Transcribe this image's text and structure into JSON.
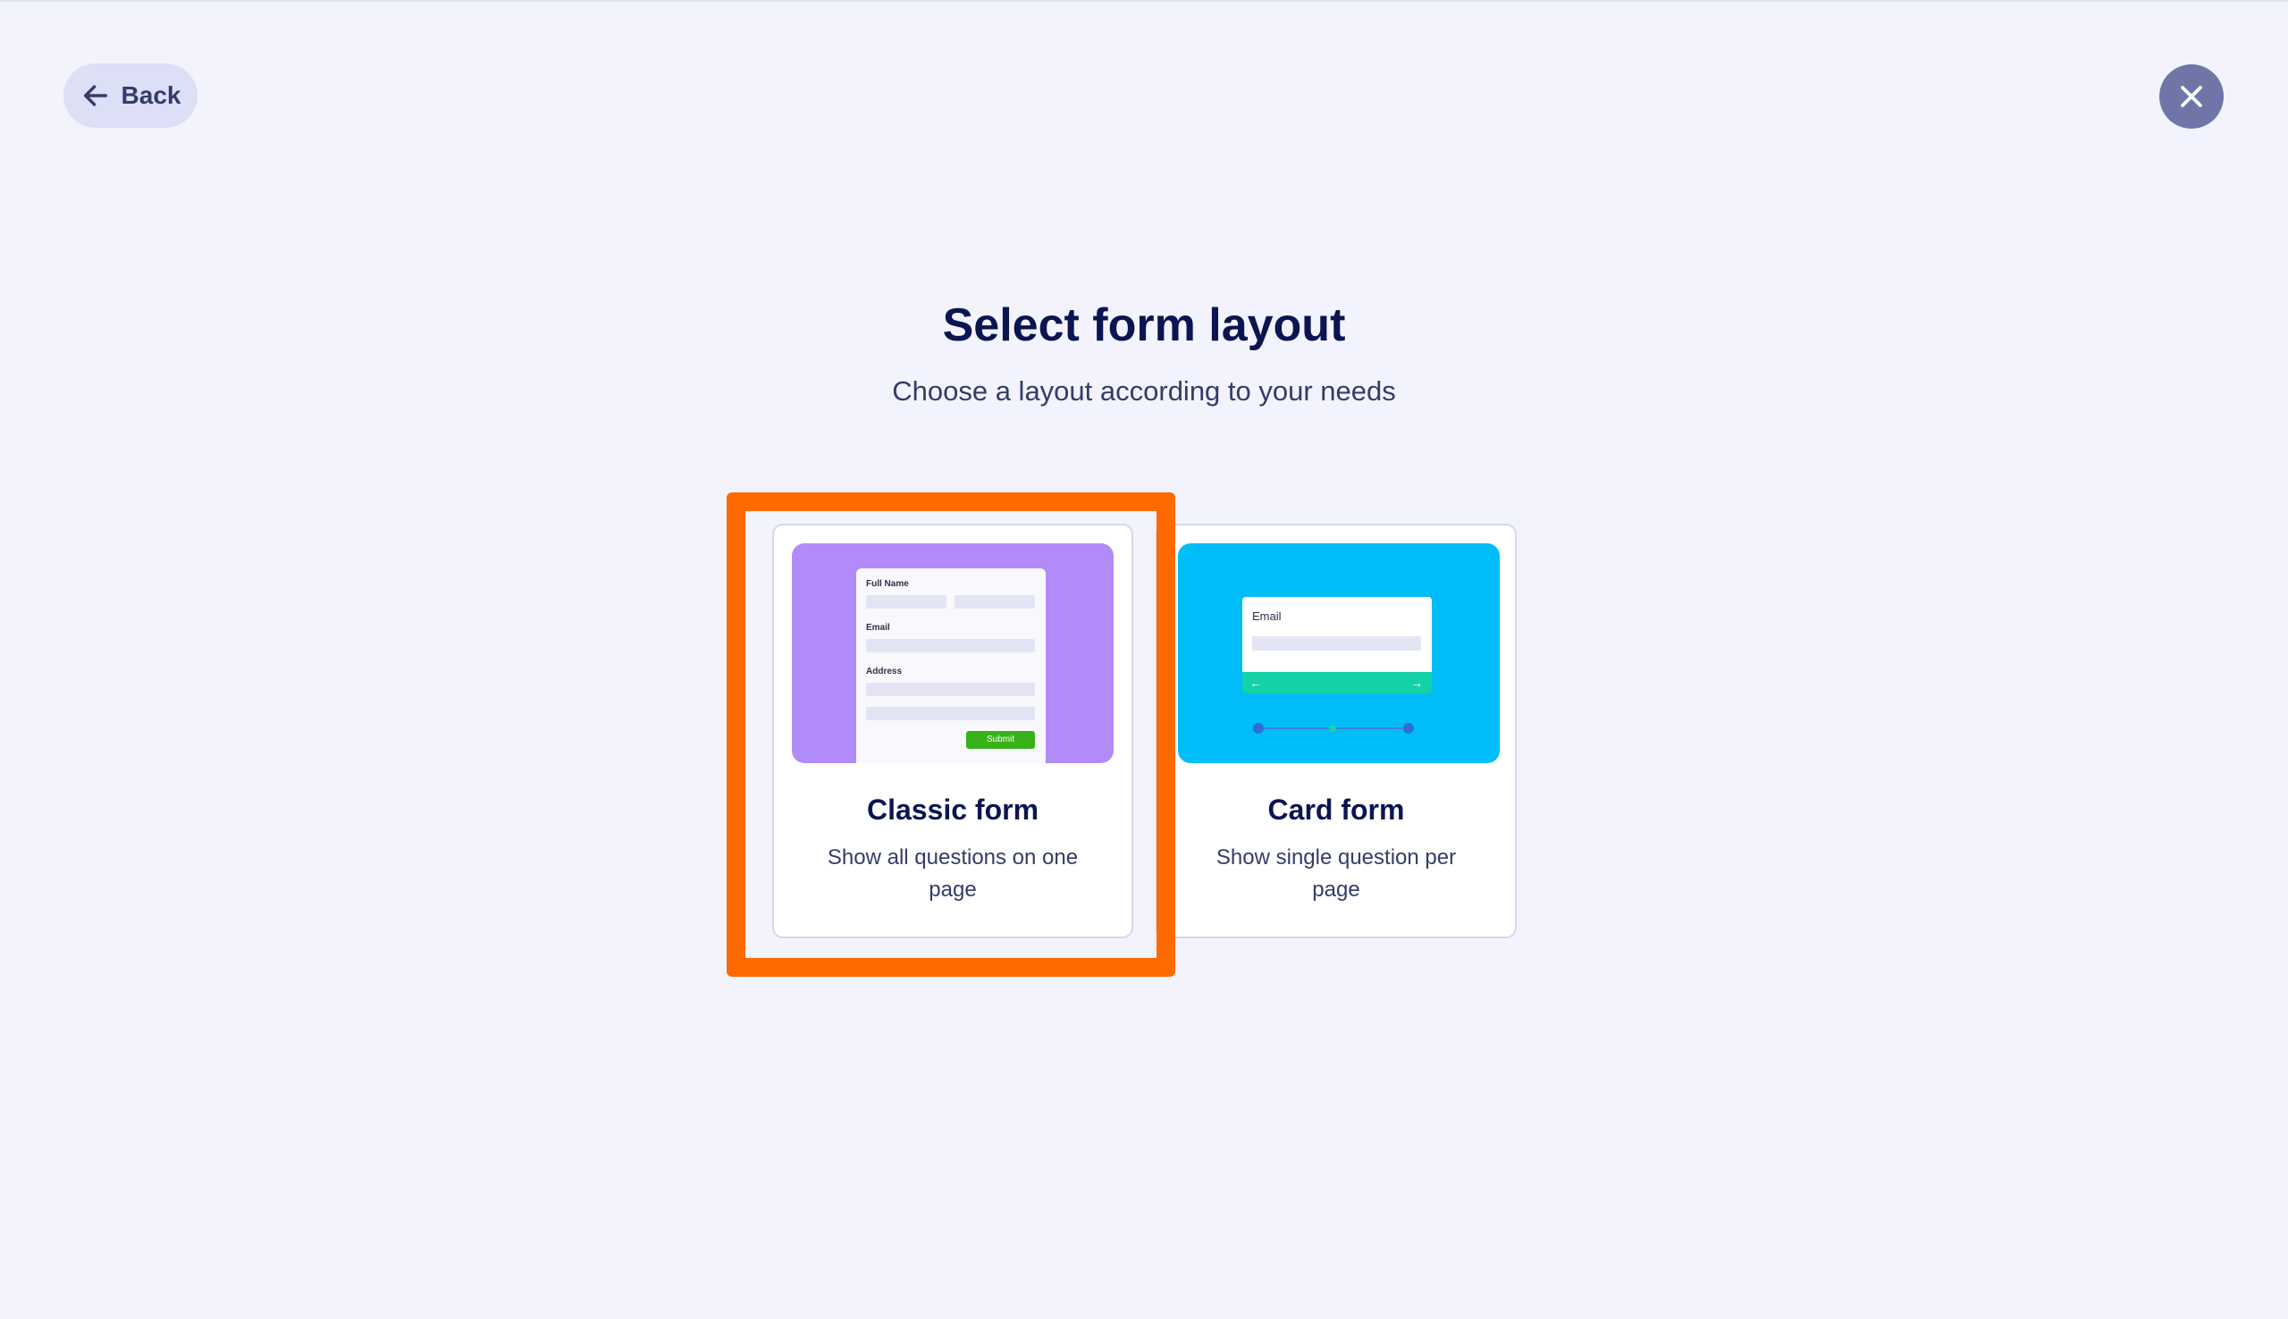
{
  "header": {
    "back_label": "Back",
    "back_icon": "arrow-left-icon",
    "close_icon": "close-icon"
  },
  "main": {
    "title": "Select form layout",
    "subtitle": "Choose a layout according to your needs"
  },
  "layouts": [
    {
      "title": "Classic form",
      "description": "Show all questions on one page",
      "selected": true,
      "preview": {
        "background": "#b18cf8",
        "field_labels": [
          "Full Name",
          "Email",
          "Address"
        ],
        "submit_label": "Submit"
      }
    },
    {
      "title": "Card form",
      "description": "Show single question per page",
      "selected": false,
      "preview": {
        "background": "#00bdf8",
        "field_label": "Email",
        "nav_left": "←",
        "nav_right": "→"
      }
    }
  ],
  "colors": {
    "page_background": "#f2f3fd",
    "highlight": "#ff6a00",
    "heading": "#0a1551",
    "close_button": "#6f76a7",
    "back_button": "#dcdff5"
  }
}
